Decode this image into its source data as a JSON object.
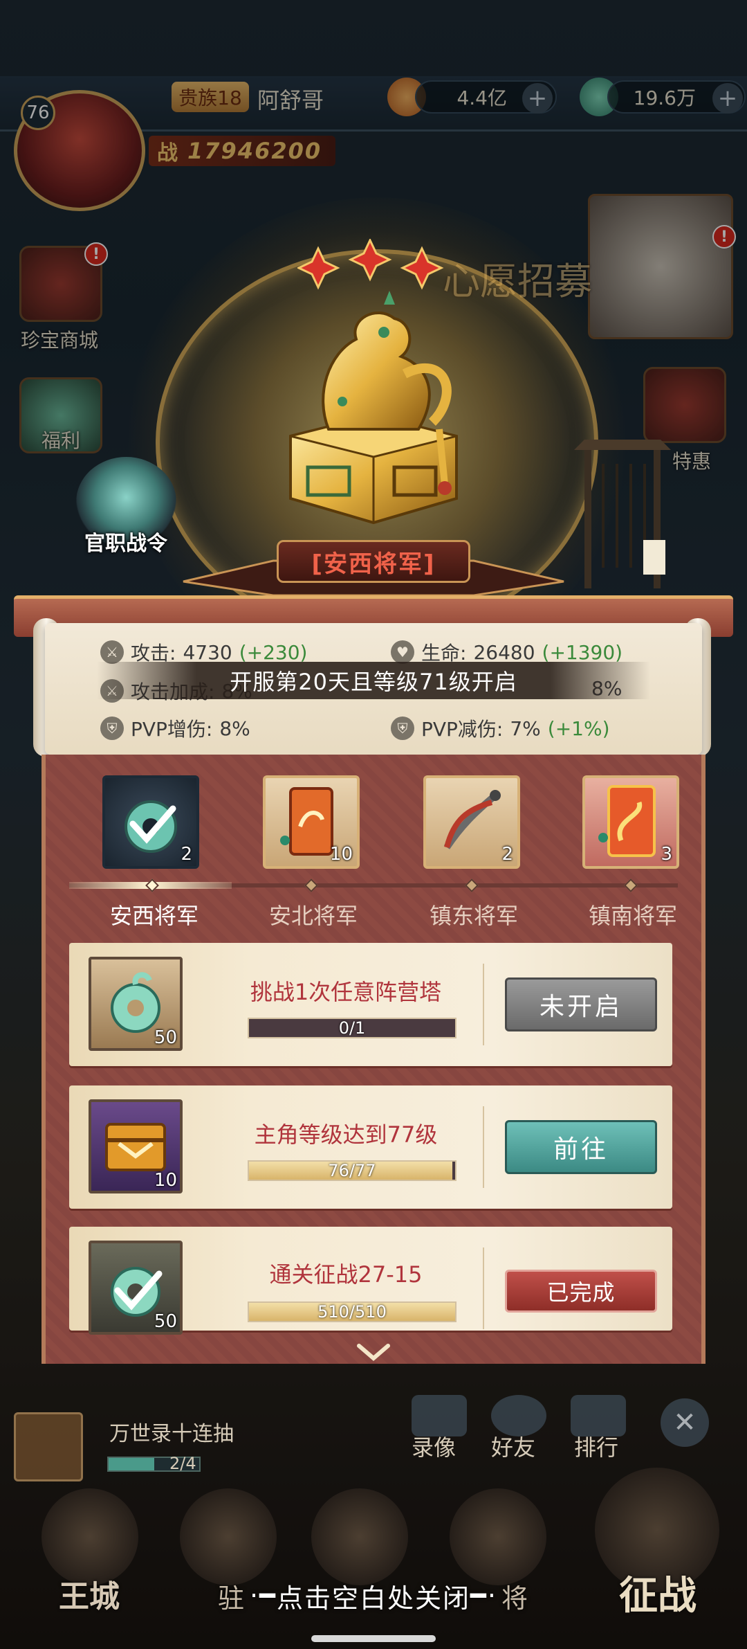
{
  "player": {
    "level": "76",
    "vip": "贵族18",
    "name": "阿舒哥",
    "power_label": "战",
    "power": "17946200",
    "currency1": "4.4亿",
    "currency2": "19.6万"
  },
  "side": {
    "shop": "珍宝商城",
    "welfare": "福利",
    "mall_label": "特惠",
    "recruit_title": "心愿招募",
    "reddot": "!"
  },
  "rank_badge": {
    "label": "官职战令"
  },
  "rank": {
    "title": "[安西将军]",
    "stars": 3
  },
  "stats": {
    "attack_label": "攻击:",
    "attack_value": "4730",
    "attack_bonus": "(+230)",
    "hp_label": "生命:",
    "hp_value": "26480",
    "hp_bonus": "(+1390)",
    "atk_pct_label": "攻击加成:",
    "atk_pct_value": "8%",
    "hp_pct_value": "8%",
    "pvp_dmg_label": "PVP增伤:",
    "pvp_dmg_value": "8%",
    "pvp_red_label": "PVP减伤:",
    "pvp_red_value": "7%",
    "pvp_red_bonus": "(+1%)",
    "unlock_banner": "开服第20天且等级71级开启"
  },
  "tabs": [
    {
      "label": "安西将军",
      "count": "2",
      "icon": "jade-pendant-icon",
      "active": true
    },
    {
      "label": "安北将军",
      "count": "10",
      "icon": "orange-token-icon",
      "active": false
    },
    {
      "label": "镇东将军",
      "count": "2",
      "icon": "shears-icon",
      "active": false
    },
    {
      "label": "镇南将军",
      "count": "3",
      "icon": "dragon-token-icon",
      "active": false
    }
  ],
  "tasks": [
    {
      "name": "挑战1次任意阵营塔",
      "progress": "0/1",
      "ratio": 0.0,
      "reward_count": "50",
      "button": "未开启",
      "state": "locked",
      "icon": "jade-pendant-icon"
    },
    {
      "name": "主角等级达到77级",
      "progress": "76/77",
      "ratio": 0.987,
      "reward_count": "10",
      "button": "前往",
      "state": "go",
      "icon": "purple-chest-icon"
    },
    {
      "name": "通关征战27-15",
      "progress": "510/510",
      "ratio": 1.0,
      "reward_count": "50",
      "button": "已完成",
      "state": "done",
      "icon": "jade-pendant-icon"
    }
  ],
  "bottom": {
    "gacha_label": "万世录十连抽",
    "gacha_progress": "2/4",
    "video": "录像",
    "friends": "好友",
    "rank": "排行",
    "main_city": "王城",
    "camp": "驻",
    "general": "将",
    "battle": "征战",
    "close_hint": "点击空白处关闭"
  },
  "colors": {
    "accent_gold": "#d7b177",
    "title_red": "#f0624a",
    "task_red": "#b0343c",
    "go_button": "#4a9a96",
    "done_button": "#b0443c",
    "locked_button": "#7d7d7d"
  }
}
